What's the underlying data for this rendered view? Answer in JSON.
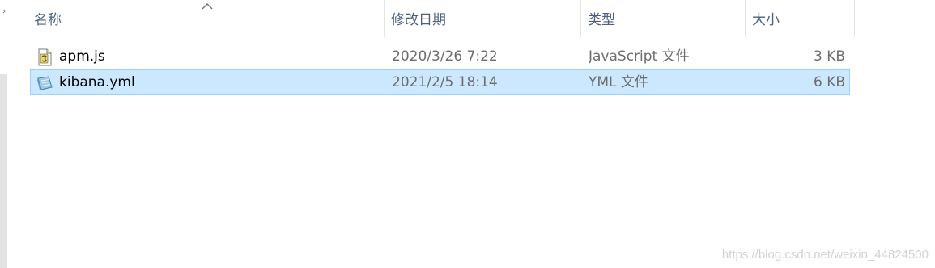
{
  "header": {
    "columns": {
      "name": "名称",
      "date": "修改日期",
      "type": "类型",
      "size": "大小"
    },
    "sort": "ascending"
  },
  "files": [
    {
      "name": "apm.js",
      "date": "2020/3/26 7:22",
      "type": "JavaScript 文件",
      "size": "3 KB",
      "icon": "js-script-icon",
      "selected": false
    },
    {
      "name": "kibana.yml",
      "date": "2021/2/5 18:14",
      "type": "YML 文件",
      "size": "6 KB",
      "icon": "yml-file-icon",
      "selected": true
    }
  ],
  "watermark": "https://blog.csdn.net/weixin_44824500",
  "colors": {
    "header_text": "#4d6082",
    "selection_bg": "#cce8ff",
    "selection_border": "#99d1ff"
  }
}
